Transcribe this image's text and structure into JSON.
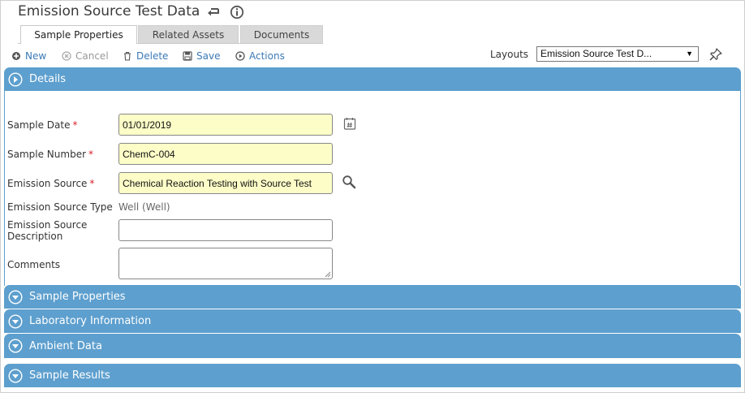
{
  "header": {
    "title": "Emission Source Test Data"
  },
  "tabs": [
    {
      "label": "Sample Properties",
      "active": true
    },
    {
      "label": "Related Assets",
      "active": false
    },
    {
      "label": "Documents",
      "active": false
    }
  ],
  "toolbar": {
    "new_label": "New",
    "cancel_label": "Cancel",
    "delete_label": "Delete",
    "save_label": "Save",
    "actions_label": "Actions"
  },
  "layouts": {
    "label": "Layouts",
    "selected": "Emission Source Test D..."
  },
  "sections": {
    "details": "Details",
    "sample_properties": "Sample Properties",
    "laboratory_information": "Laboratory Information",
    "ambient_data": "Ambient Data",
    "sample_results": "Sample Results"
  },
  "form": {
    "sample_date": {
      "label": "Sample Date",
      "value": "01/01/2019",
      "required": "*"
    },
    "sample_number": {
      "label": "Sample Number",
      "value": "ChemC-004",
      "required": "*"
    },
    "emission_source": {
      "label": "Emission Source",
      "value": "Chemical Reaction Testing with Source Test",
      "required": "*"
    },
    "emission_source_type": {
      "label": "Emission Source Type",
      "value": "Well (Well)"
    },
    "emission_source_description": {
      "label_line1": "Emission Source",
      "label_line2": "Description",
      "value": ""
    },
    "comments": {
      "label": "Comments",
      "value": ""
    }
  },
  "colors": {
    "section_bar": "#5d9fce",
    "required_field_bg": "#fdfdc8",
    "link": "#3b7ab6",
    "required_marker": "#d81f2a"
  },
  "icons": [
    "undo-icon",
    "info-icon",
    "plus-circle-icon",
    "cancel-circle-icon",
    "trash-icon",
    "save-icon",
    "actions-play-icon",
    "pin-icon",
    "calendar-icon",
    "search-icon",
    "chevron-right-circle-icon",
    "chevron-down-circle-icon"
  ]
}
